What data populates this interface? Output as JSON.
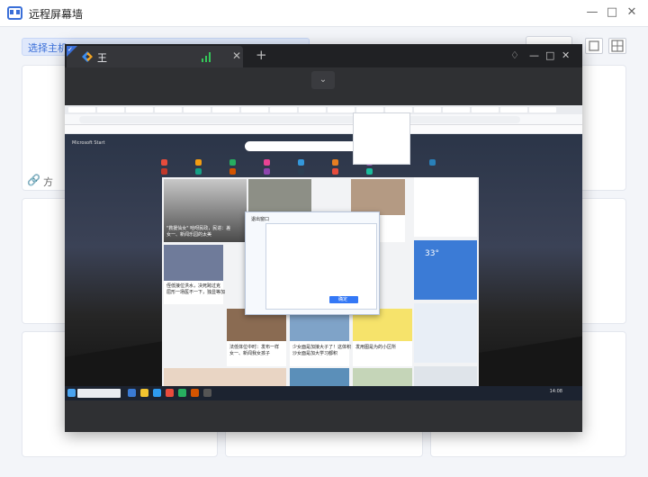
{
  "app": {
    "title": "远程屏幕墙",
    "window_controls": {
      "minimize_icon": "minimize-icon",
      "maximize_icon": "maximize-icon",
      "close_icon": "close-icon"
    }
  },
  "toolbar": {
    "hint": "选择主机",
    "layout_icons": [
      "single-view-icon",
      "grid-view-icon"
    ]
  },
  "grid": {
    "cell_label": "方"
  },
  "session": {
    "tab_name": "王",
    "signal_icon": "signal-strength-icon",
    "new_tab_symbol": "+",
    "collapse_icon": "chevron-down-icon",
    "controls": [
      "pin-icon",
      "minimize-icon",
      "maximize-icon",
      "close-icon"
    ],
    "accent_color": "#3a6fd8",
    "signal_color": "#34c759"
  },
  "remote": {
    "msn_header": "Microsoft Start",
    "headline_1": "\"救援仙女\" 哈呀民政，民进：差",
    "headline_1b": "女一、新闻乐园的太美",
    "headline_2": "侄低接位洪水，决死跨过克",
    "headline_2b": "屈形一场医不一下，独显等加",
    "headline_3": "法低体位中时：发布一样",
    "headline_3b": "女一、新闻我女孩子",
    "headline_4": "少女面是加接大子了！这体积",
    "headline_4b": "沙女面是加大学习都积",
    "headline_5": "发用图是为的小区所",
    "weather_temp": "33°",
    "dialog_title": "退出窗口",
    "dialog_button": "确定",
    "clock": "14:08"
  }
}
